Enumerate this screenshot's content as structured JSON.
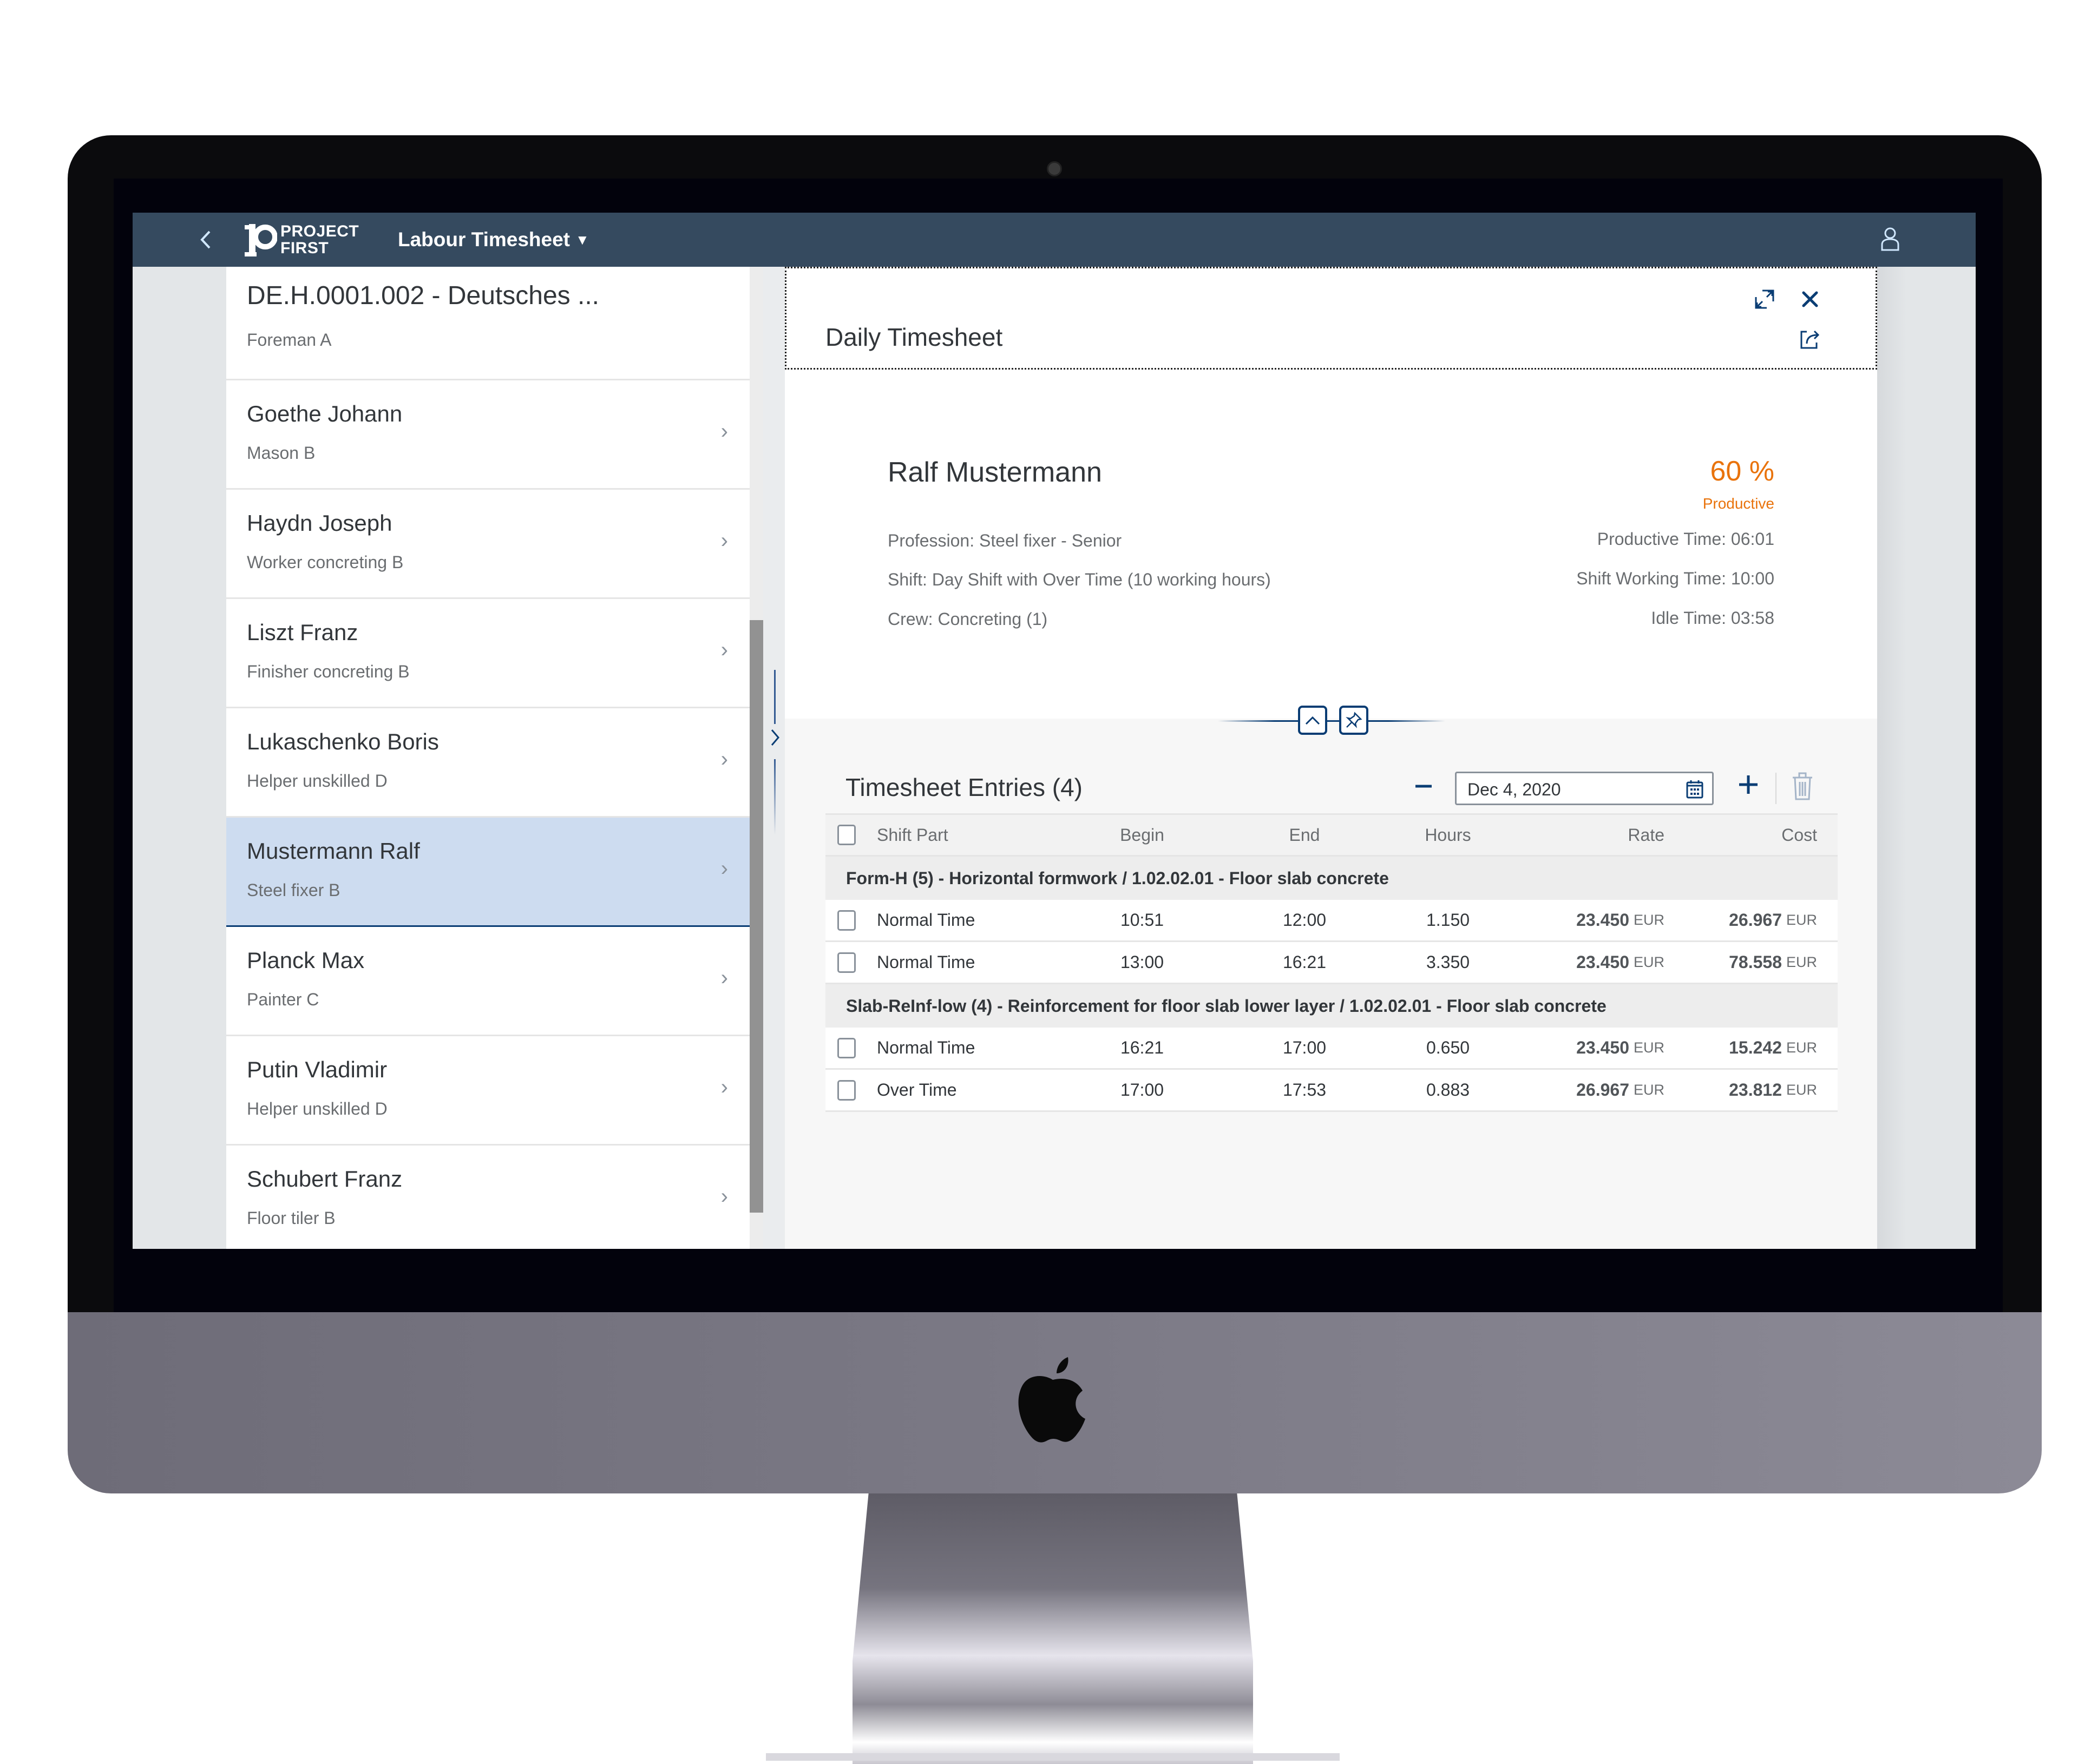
{
  "shell": {
    "logo_line1": "PROJECT",
    "logo_line2": "FIRST",
    "app_title": "Labour Timesheet",
    "back_icon": "chevron-left-icon",
    "user_icon": "person-icon"
  },
  "list": {
    "header": {
      "title": "DE.H.0001.002 - Deutsches ...",
      "description": "Foreman A"
    },
    "items": [
      {
        "title": "Goethe Johann",
        "description": "Mason B",
        "selected": false
      },
      {
        "title": "Haydn Joseph",
        "description": "Worker concreting B",
        "selected": false
      },
      {
        "title": "Liszt Franz",
        "description": "Finisher concreting B",
        "selected": false
      },
      {
        "title": "Lukaschenko Boris",
        "description": "Helper unskilled D",
        "selected": false
      },
      {
        "title": "Mustermann Ralf",
        "description": "Steel fixer B",
        "selected": true
      },
      {
        "title": "Planck Max",
        "description": "Painter C",
        "selected": false
      },
      {
        "title": "Putin Vladimir",
        "description": "Helper unskilled D",
        "selected": false
      },
      {
        "title": "Schubert Franz",
        "description": "Floor tiler B",
        "selected": false
      }
    ],
    "chevron": "›"
  },
  "detail": {
    "title": "Daily Timesheet",
    "actions": [
      "fullscreen-icon",
      "close-icon",
      "share-icon"
    ],
    "object": {
      "name": "Ralf Mustermann",
      "kpi_value": "60 %",
      "kpi_label": "Productive",
      "attributes_left": [
        "Profession: Steel fixer - Senior",
        "Shift: Day Shift with Over Time (10 working hours)",
        "Crew: Concreting (1)"
      ],
      "attributes_right": [
        "Productive Time: 06:01",
        "Shift Working Time: 10:00",
        "Idle Time: 03:58"
      ]
    },
    "table": {
      "title": "Timesheet Entries (4)",
      "date_value": "Dec 4, 2020",
      "minus_label": "−",
      "plus_label": "+",
      "columns": [
        "Shift Part",
        "Begin",
        "End",
        "Hours",
        "Rate",
        "Cost"
      ],
      "groups": [
        {
          "label": "Form-H (5) - Horizontal formwork / 1.02.02.01 - Floor slab concrete",
          "rows": [
            {
              "part": "Normal Time",
              "begin": "10:51",
              "end": "12:00",
              "hours": "1.150",
              "rate": "23.450",
              "rate_cur": "EUR",
              "cost": "26.967",
              "cost_cur": "EUR"
            },
            {
              "part": "Normal Time",
              "begin": "13:00",
              "end": "16:21",
              "hours": "3.350",
              "rate": "23.450",
              "rate_cur": "EUR",
              "cost": "78.558",
              "cost_cur": "EUR"
            }
          ]
        },
        {
          "label": "Slab-ReInf-low (4) - Reinforcement for floor slab lower layer / 1.02.02.01 - Floor slab concrete",
          "rows": [
            {
              "part": "Normal Time",
              "begin": "16:21",
              "end": "17:00",
              "hours": "0.650",
              "rate": "23.450",
              "rate_cur": "EUR",
              "cost": "15.242",
              "cost_cur": "EUR"
            },
            {
              "part": "Over Time",
              "begin": "17:00",
              "end": "17:53",
              "hours": "0.883",
              "rate": "26.967",
              "rate_cur": "EUR",
              "cost": "23.812",
              "cost_cur": "EUR"
            }
          ]
        }
      ]
    }
  },
  "colors": {
    "shell_bg": "#354a5f",
    "accent": "#0a3d74",
    "kpi_orange": "#e9730c",
    "selected_bg": "#cddcf0"
  }
}
